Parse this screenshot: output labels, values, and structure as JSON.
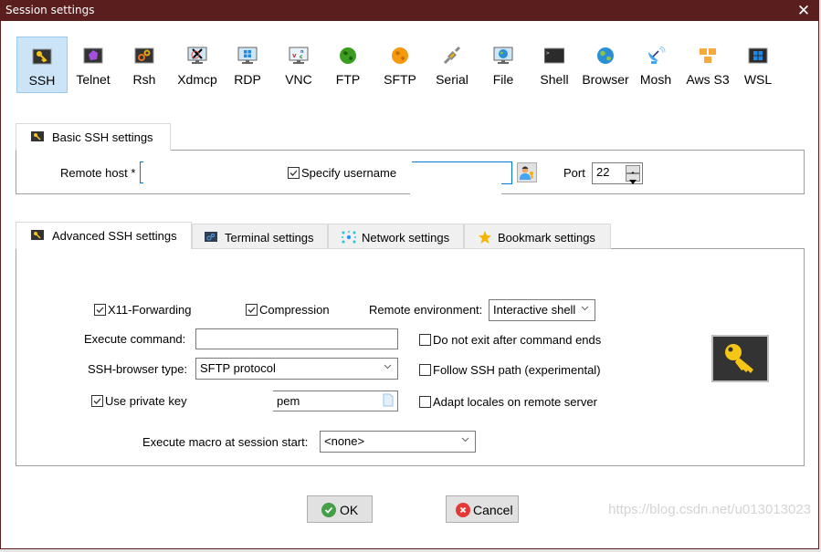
{
  "window": {
    "title": "Session settings",
    "close_label": "✕"
  },
  "protocols": [
    {
      "label": "SSH",
      "icon": "ssh-key-icon",
      "selected": true
    },
    {
      "label": "Telnet",
      "icon": "telnet-icon"
    },
    {
      "label": "Rsh",
      "icon": "rsh-gears-icon"
    },
    {
      "label": "Xdmcp",
      "icon": "xdmcp-monitor-icon"
    },
    {
      "label": "RDP",
      "icon": "rdp-monitor-icon"
    },
    {
      "label": "VNC",
      "icon": "vnc-monitor-icon"
    },
    {
      "label": "FTP",
      "icon": "ftp-globe-icon"
    },
    {
      "label": "SFTP",
      "icon": "sftp-globe-icon"
    },
    {
      "label": "Serial",
      "icon": "serial-plug-icon"
    },
    {
      "label": "File",
      "icon": "file-monitor-icon"
    },
    {
      "label": "Shell",
      "icon": "shell-terminal-icon"
    },
    {
      "label": "Browser",
      "icon": "browser-globe-icon"
    },
    {
      "label": "Mosh",
      "icon": "mosh-satellite-icon"
    },
    {
      "label": "Aws S3",
      "icon": "aws-s3-cubes-icon"
    },
    {
      "label": "WSL",
      "icon": "wsl-windows-icon"
    }
  ],
  "basic": {
    "tab_label": "Basic SSH settings",
    "remote_host_label": "Remote host *",
    "remote_host_value": "",
    "specify_username_label": "Specify username",
    "specify_username_checked": true,
    "username_value": "",
    "port_label": "Port",
    "port_value": "22"
  },
  "advanced_tabs": [
    {
      "label": "Advanced SSH settings",
      "active": true
    },
    {
      "label": "Terminal settings"
    },
    {
      "label": "Network settings"
    },
    {
      "label": "Bookmark settings"
    }
  ],
  "advanced": {
    "x11_forwarding_label": "X11-Forwarding",
    "x11_forwarding_checked": true,
    "compression_label": "Compression",
    "compression_checked": true,
    "remote_env_label": "Remote environment:",
    "remote_env_value": "Interactive shell",
    "execute_command_label": "Execute command:",
    "execute_command_value": "",
    "do_not_exit_label": "Do not exit after command ends",
    "do_not_exit_checked": false,
    "ssh_browser_label": "SSH-browser type:",
    "ssh_browser_value": "SFTP protocol",
    "follow_ssh_path_label": "Follow SSH path (experimental)",
    "follow_ssh_path_checked": false,
    "use_private_key_label": "Use private key",
    "use_private_key_checked": true,
    "private_key_value": "pem",
    "adapt_locales_label": "Adapt locales on remote server",
    "adapt_locales_checked": false,
    "macro_label": "Execute macro at session start:",
    "macro_value": "<none>"
  },
  "buttons": {
    "ok_label": "OK",
    "cancel_label": "Cancel"
  },
  "watermark": "https://blog.csdn.net/u013013023"
}
